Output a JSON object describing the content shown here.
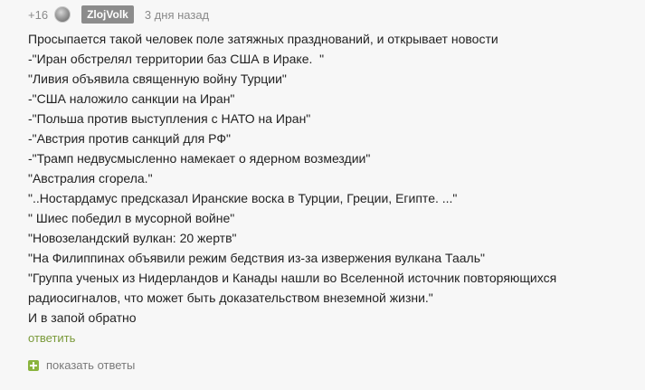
{
  "comment": {
    "rating": "+16",
    "author": "ZlojVolk",
    "time": "3 дня назад",
    "lines": [
      "Просыпается такой человек поле затяжных празднований, и открывает новости",
      "-\"Иран обстрелял территории баз США в Ираке.  \"",
      "\"Ливия объявила священную войну Турции\"",
      "-\"США наложило санкции на Иран\"",
      "-\"Польша против выступления с НАТО на Иран\"",
      "-\"Австрия против санкций для РФ\"",
      "-\"Трамп недвусмысленно намекает о ядерном возмездии\"",
      "\"Австралия сгорела.\"",
      "\"..Ностардамус предсказал Иранские воска в Турции, Греции, Египте. ...\"",
      "\" Шиес победил в мусорной войне\"",
      "\"Новозеландский вулкан: 20 жертв\"",
      "\"На Филиппинах объявили режим бедствия из-за извержения вулкана Тааль\"",
      "\"Группа ученых из Нидерландов и Канады нашли во Вселенной источник повторяющихся",
      "радиосигналов, что может быть доказательством внеземной жизни.\"",
      "И в запой обратно"
    ],
    "reply_label": "ответить",
    "show_replies_label": "показать ответы"
  },
  "colors": {
    "background": "#f7f7f7",
    "author_badge": "#8c8c8c",
    "link_green": "#7a9a3a",
    "plus_green": "#8ab43e"
  },
  "icons": {
    "avatar": "avatar-icon",
    "show_replies": "plus-icon"
  }
}
